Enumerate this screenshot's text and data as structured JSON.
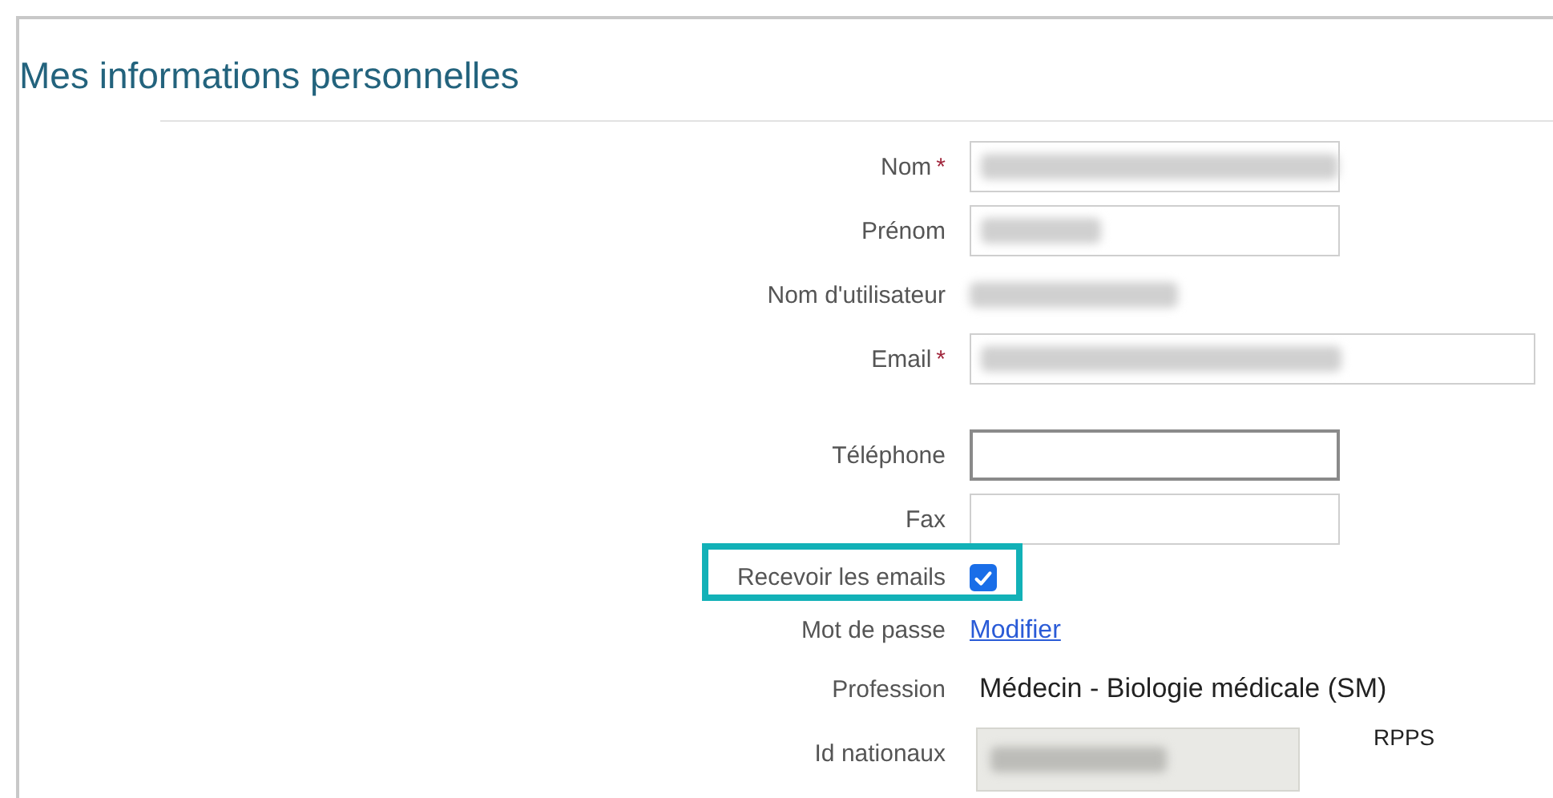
{
  "title": "Mes informations personnelles",
  "fields": [
    {
      "kind": "input",
      "label": "Nom",
      "required_mark": "*",
      "redacted": true,
      "wide": false,
      "focused": false
    },
    {
      "kind": "input",
      "label": "Prénom",
      "redacted": true,
      "wide": false,
      "focused": false
    },
    {
      "kind": "text",
      "label": "Nom d'utilisateur",
      "redacted": true
    },
    {
      "kind": "input",
      "label": "Email",
      "required_mark": "*",
      "redacted": true,
      "wide": true,
      "focused": false
    },
    {
      "kind": "input",
      "label": "Téléphone",
      "wide": false,
      "focused": true
    },
    {
      "kind": "input",
      "label": "Fax",
      "wide": false,
      "focused": false
    },
    {
      "kind": "checkbox",
      "label": "Recevoir les emails",
      "checked": true,
      "highlighted": true
    },
    {
      "kind": "link",
      "label": "Mot de passe",
      "value": "Modifier"
    },
    {
      "kind": "text",
      "label": "Profession",
      "value": "Médecin - Biologie médicale (SM)"
    },
    {
      "kind": "readonly",
      "label": "Id nationaux",
      "redacted": true,
      "suffix": "RPPS"
    }
  ]
}
